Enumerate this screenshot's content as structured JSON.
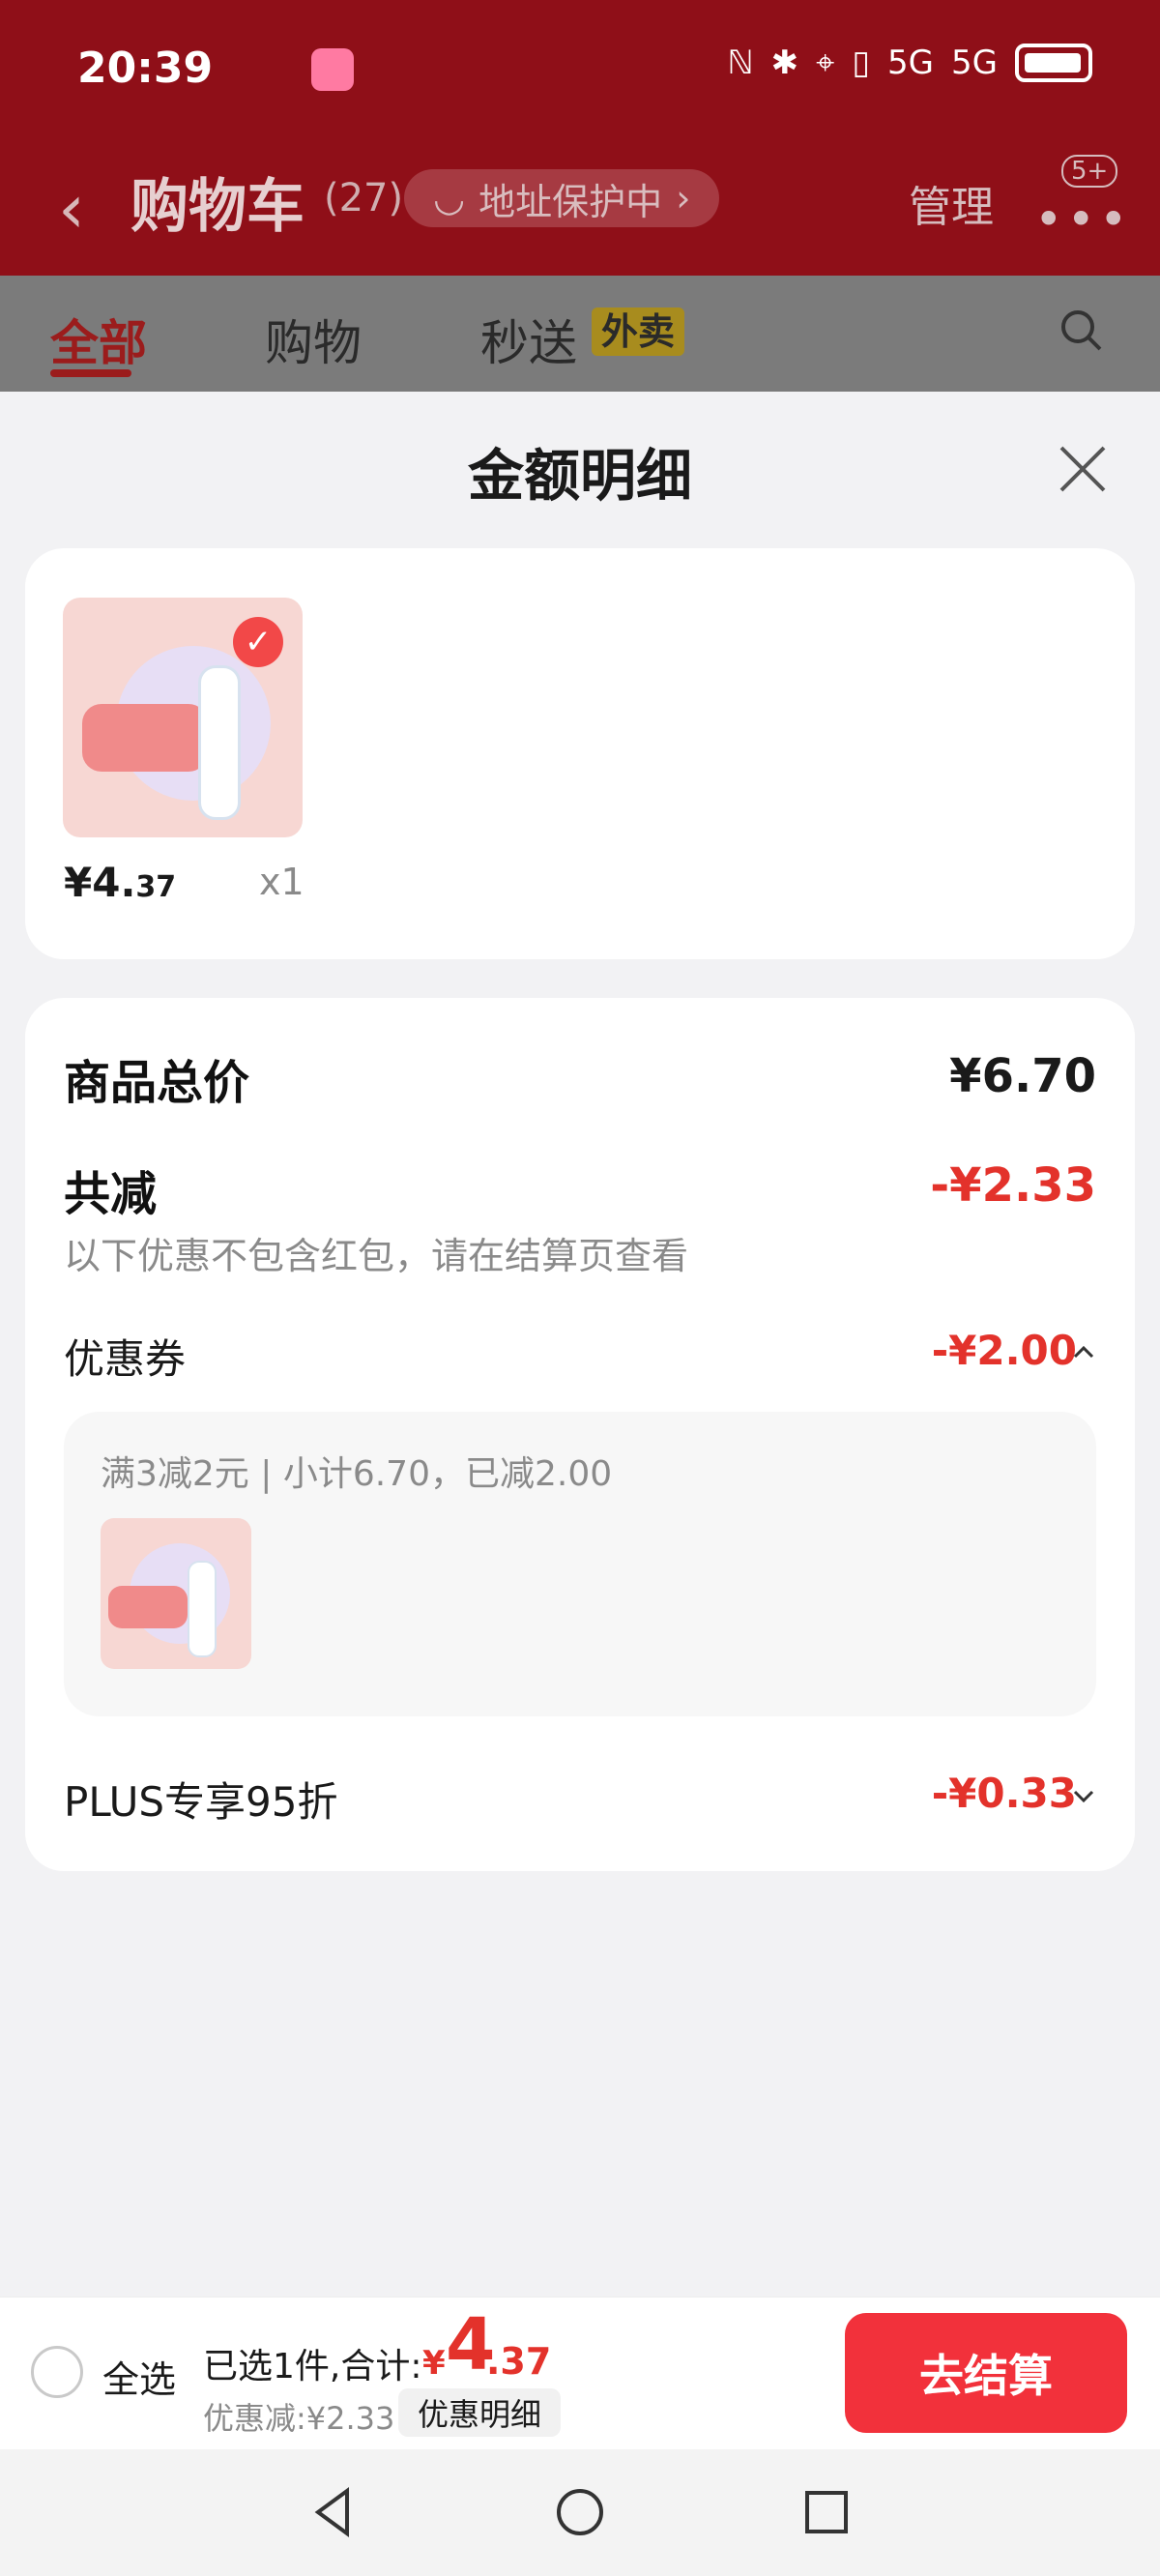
{
  "status_bar": {
    "time": "20:39",
    "icons": [
      "signal-icon",
      "bluetooth-icon",
      "location-icon",
      "vibrate-icon",
      "5g-signal-icon",
      "5g-signal-icon",
      "battery-icon"
    ]
  },
  "header": {
    "title": "购物车",
    "count": "(27)",
    "address_pill": "地址保护中",
    "manage": "管理",
    "more_badge": "5+",
    "tabs": [
      "全部",
      "购物",
      "秒送"
    ],
    "tag_waimai": "外卖"
  },
  "modal": {
    "title": "金额明细",
    "product": {
      "price_main": "¥4.",
      "price_cents": "37",
      "qty": "x1"
    },
    "breakdown": {
      "total_label": "商品总价",
      "total_value": "¥6.70",
      "reduce_label": "共减",
      "reduce_value": "-¥2.33",
      "note": "以下优惠不包含红包，请在结算页查看",
      "coupon_label": "优惠券",
      "coupon_value": "-¥2.00",
      "coupon_text": "满3减2元 | 小计6.70，已减2.00",
      "plus_label": "PLUS专享95折",
      "plus_value": "-¥0.33"
    }
  },
  "bottom_bar": {
    "select_all": "全选",
    "selected_summary": "已选1件,合计:",
    "total_yen": "¥",
    "total_big": "4",
    "total_cents": ".37",
    "discount_text": "优惠减:¥2.33",
    "detail_button": "优惠明细",
    "checkout": "去结算"
  },
  "colors": {
    "accent_red": "#e3322b",
    "checkout_red": "#f2313b",
    "header_dark_red": "#8f0f18"
  }
}
